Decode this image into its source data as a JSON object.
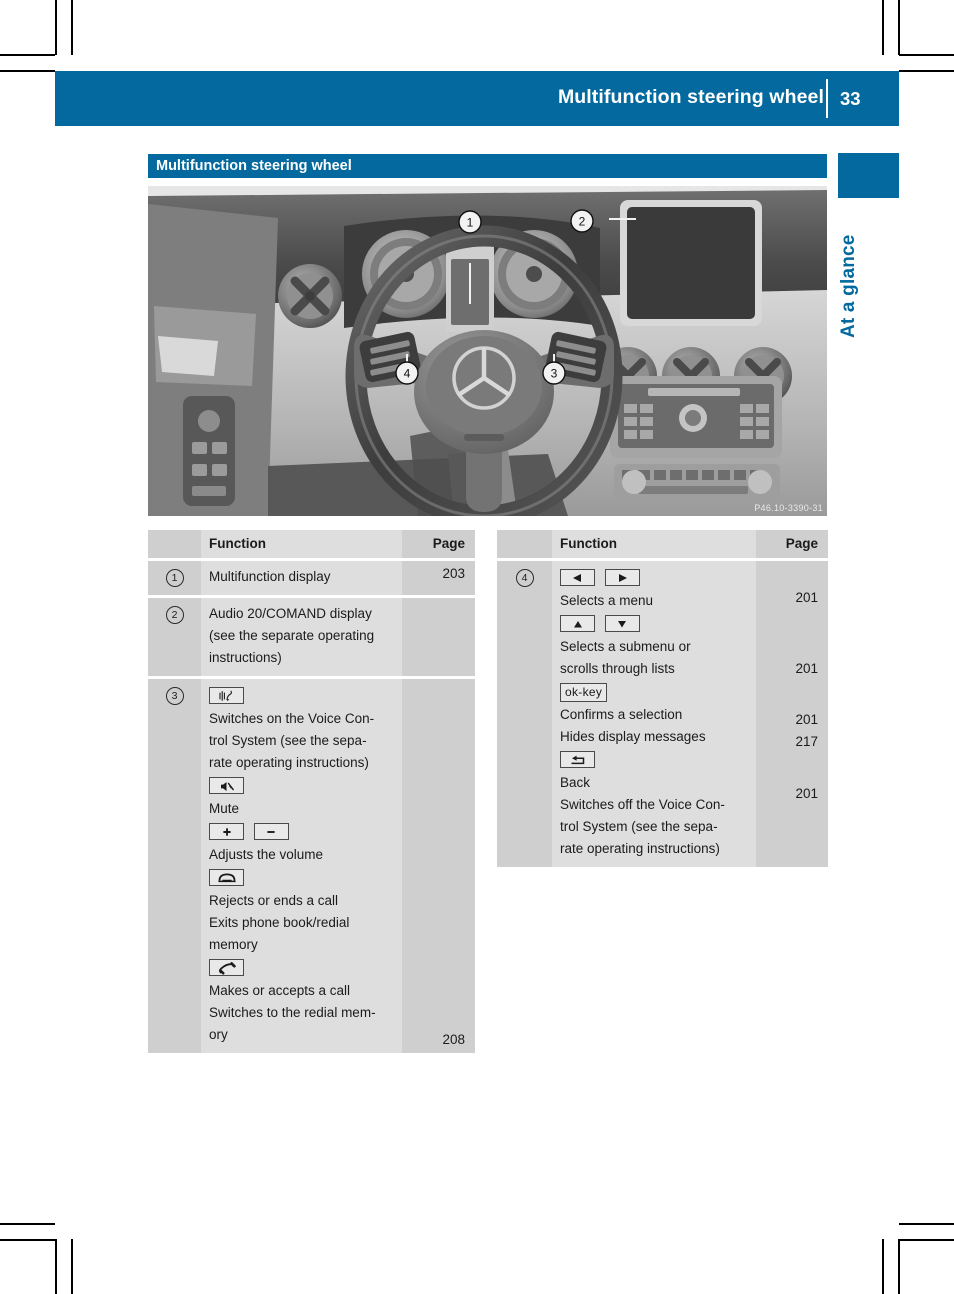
{
  "header": {
    "title": "Multifunction steering wheel",
    "page_number": "33"
  },
  "thumb_tab": {
    "label": "At a glance"
  },
  "section": {
    "heading": "Multifunction steering wheel"
  },
  "figure": {
    "watermark": "P46.10-3390-31",
    "callouts": [
      "1",
      "2",
      "3",
      "4"
    ],
    "description": "Mercedes-Benz cockpit with multifunction steering wheel"
  },
  "tables": {
    "left": {
      "headers": {
        "function": "Function",
        "page": "Page"
      },
      "rows": [
        {
          "callout": "1",
          "lines": [
            {
              "text": "Multifunction display"
            }
          ],
          "page": "203"
        },
        {
          "callout": "2",
          "lines": [
            {
              "text": "Audio 20/COMAND display"
            },
            {
              "text": "(see the separate operating"
            },
            {
              "text": "instructions)"
            }
          ],
          "page": ""
        },
        {
          "callout": "3",
          "lines": [
            {
              "icons": [
                "voice-control-icon"
              ]
            },
            {
              "text": "Switches on the Voice Con-"
            },
            {
              "text": "trol System (see the sepa-"
            },
            {
              "text": "rate operating instructions)"
            },
            {
              "icons": [
                "mute-icon"
              ]
            },
            {
              "text": "Mute"
            },
            {
              "icons": [
                "plus-icon",
                "minus-icon"
              ]
            },
            {
              "text": "Adjusts the volume"
            },
            {
              "icons": [
                "end-call-icon"
              ]
            },
            {
              "text": "Rejects or ends a call"
            },
            {
              "text": "Exits phone book/redial"
            },
            {
              "text": "memory"
            },
            {
              "icons": [
                "accept-call-icon"
              ]
            },
            {
              "text": "Makes or accepts a call"
            },
            {
              "text": "Switches to the redial mem-"
            },
            {
              "text": "ory"
            }
          ],
          "page": "208"
        }
      ]
    },
    "right": {
      "headers": {
        "function": "Function",
        "page": "Page"
      },
      "rows": [
        {
          "callout": "4",
          "lines": [
            {
              "icons": [
                "arrow-left-icon",
                "arrow-right-icon"
              ]
            },
            {
              "text": "Selects a menu",
              "page": "201"
            },
            {
              "icons": [
                "arrow-up-icon",
                "arrow-down-icon"
              ]
            },
            {
              "text": "Selects a submenu or"
            },
            {
              "text": "scrolls through lists",
              "page": "201"
            },
            {
              "icons": [
                "ok-key"
              ]
            },
            {
              "text": "Confirms a selection",
              "page": "201"
            },
            {
              "text": "Hides display messages",
              "page": "217"
            },
            {
              "icons": [
                "back-icon"
              ]
            },
            {
              "text": "Back",
              "page": "201"
            },
            {
              "text": "Switches off the Voice Con-"
            },
            {
              "text": "trol System (see the sepa-"
            },
            {
              "text": "rate operating instructions)"
            }
          ]
        }
      ]
    }
  },
  "colors": {
    "brand_blue": "#03699e",
    "table_fn_bg": "#dedede",
    "table_alt_bg": "#cfcfcf",
    "text": "#1b1b1b"
  }
}
